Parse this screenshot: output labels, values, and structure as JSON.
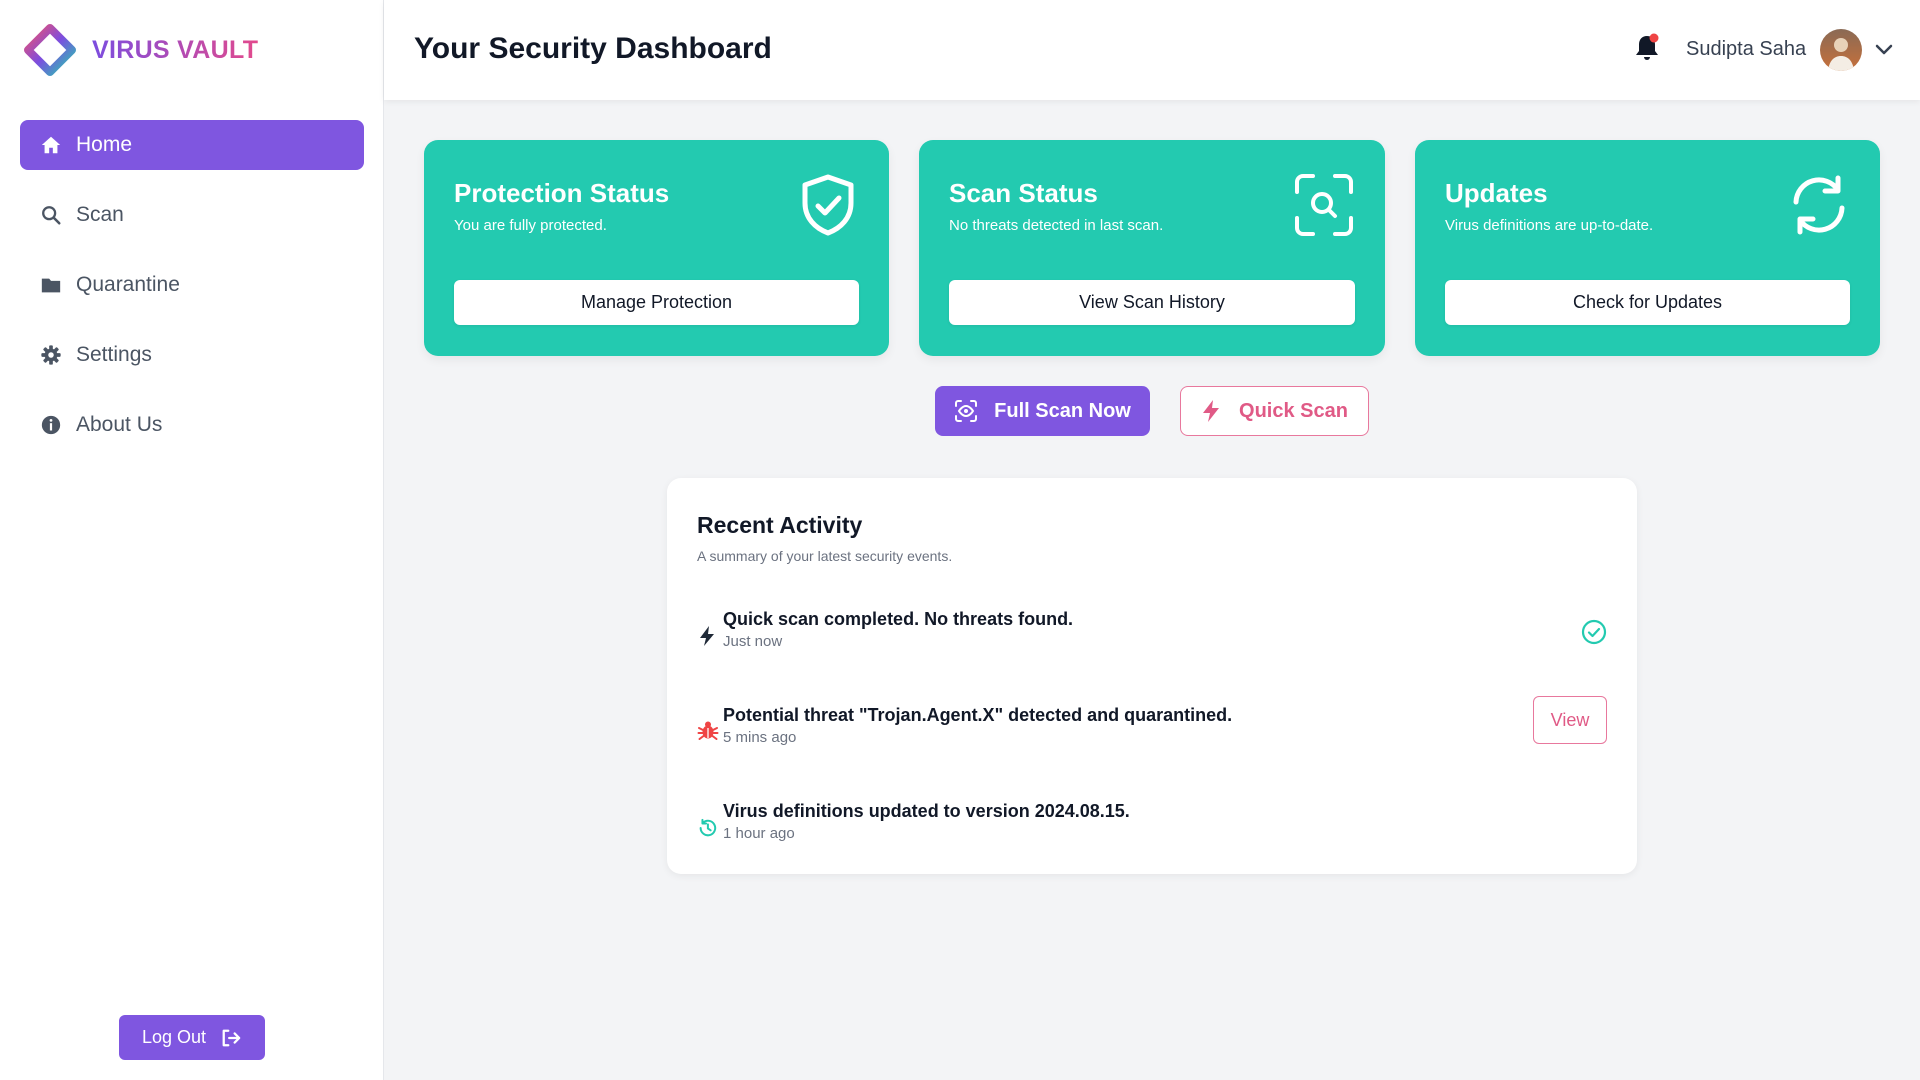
{
  "brand": {
    "name": "VIRUS VAULT"
  },
  "sidebar": {
    "items": [
      {
        "label": "Home",
        "icon": "home-icon",
        "active": true
      },
      {
        "label": "Scan",
        "icon": "search-icon"
      },
      {
        "label": "Quarantine",
        "icon": "folder-icon"
      },
      {
        "label": "Settings",
        "icon": "gear-icon"
      },
      {
        "label": "About Us",
        "icon": "info-icon"
      }
    ],
    "logout_label": "Log Out"
  },
  "header": {
    "title": "Your Security Dashboard",
    "user_name": "Sudipta Saha",
    "has_notification": true
  },
  "cards": [
    {
      "title": "Protection Status",
      "subtitle": "You are fully protected.",
      "button": "Manage Protection",
      "icon": "shield-check-icon"
    },
    {
      "title": "Scan Status",
      "subtitle": "No threats detected in last scan.",
      "button": "View Scan History",
      "icon": "scan-search-icon"
    },
    {
      "title": "Updates",
      "subtitle": "Virus definitions are up-to-date.",
      "button": "Check for Updates",
      "icon": "refresh-icon"
    }
  ],
  "actions": {
    "full_scan": "Full Scan Now",
    "quick_scan": "Quick Scan"
  },
  "activity": {
    "title": "Recent Activity",
    "subtitle": "A summary of your latest security events.",
    "items": [
      {
        "text": "Quick scan completed. No threats found.",
        "time": "Just now",
        "icon": "bolt-icon",
        "status": "check-circle-icon"
      },
      {
        "text": "Potential threat \"Trojan.Agent.X\" detected and quarantined.",
        "time": "5 mins ago",
        "icon": "bug-icon",
        "action": "View"
      },
      {
        "text": "Virus definitions updated to version 2024.08.15.",
        "time": "1 hour ago",
        "icon": "history-icon"
      }
    ]
  },
  "colors": {
    "primary": "#7f56e0",
    "teal": "#23cab0",
    "pink": "#e05a86",
    "background": "#f3f4f6"
  }
}
